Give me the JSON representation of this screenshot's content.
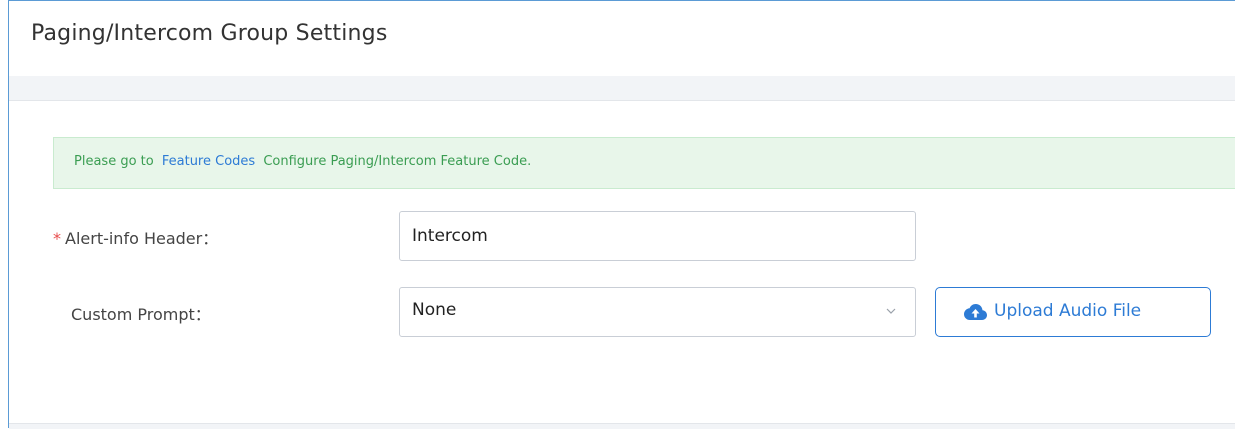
{
  "header": {
    "title": "Paging/Intercom Group Settings"
  },
  "notice": {
    "prefix": "Please go to",
    "link": "Feature Codes",
    "suffix": "Configure Paging/Intercom Feature Code."
  },
  "form": {
    "alert_info": {
      "required_mark": "*",
      "label": "Alert-info Header：",
      "value": "Intercom"
    },
    "custom_prompt": {
      "label": "Custom Prompt：",
      "selected": "None",
      "upload_label": "Upload Audio File"
    }
  },
  "colors": {
    "accent": "#2d7bd5",
    "notice_bg": "#e8f6ea",
    "notice_text": "#3a9d52",
    "required": "#e84b4b"
  },
  "icons": {
    "upload": "cloud-upload-icon",
    "select": "chevron-down-icon"
  }
}
